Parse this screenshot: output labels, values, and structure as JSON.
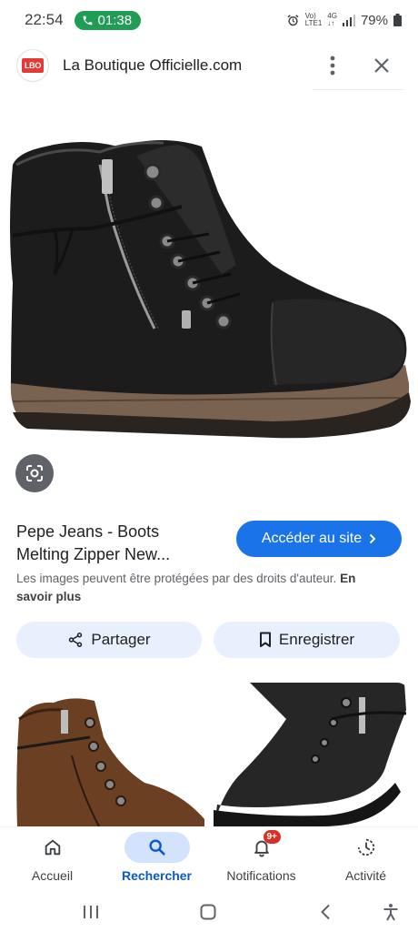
{
  "status": {
    "time": "22:54",
    "call_duration": "01:38",
    "volte": "Vo)",
    "lte": "LTE1",
    "network": "4G",
    "battery": "79%"
  },
  "header": {
    "logo_text": "LBO",
    "site_name": "La Boutique Officielle.com"
  },
  "result": {
    "title_line1": "Pepe Jeans - Boots",
    "title_line2": "Melting Zipper New...",
    "visit_label": "Accéder au site",
    "copyright_text": "Les images peuvent être protégées par des droits d'auteur.",
    "learn_more": "En savoir plus"
  },
  "actions": {
    "share_label": "Partager",
    "save_label": "Enregistrer"
  },
  "bottom_nav": {
    "items": [
      {
        "label": "Accueil",
        "icon": "home-icon"
      },
      {
        "label": "Rechercher",
        "icon": "search-icon"
      },
      {
        "label": "Notifications",
        "icon": "bell-icon",
        "badge": "9+"
      },
      {
        "label": "Activité",
        "icon": "history-icon"
      }
    ]
  },
  "colors": {
    "accent": "#1a73e8",
    "pill_bg": "#e8f0fe",
    "active_nav_bg": "#d3e3fd",
    "active_nav_text": "#0b57d0",
    "badge": "#d93025",
    "call_green": "#1f9d55"
  }
}
